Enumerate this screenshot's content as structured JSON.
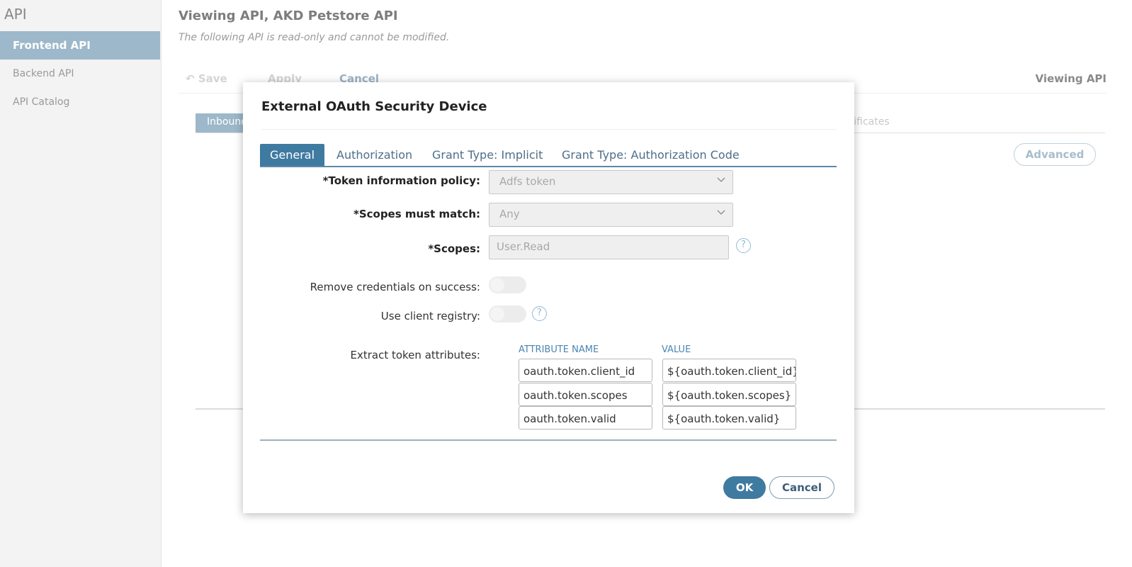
{
  "sidebar": {
    "title": "API",
    "items": [
      {
        "label": "Frontend API",
        "active": true
      },
      {
        "label": "Backend API",
        "active": false
      },
      {
        "label": "API Catalog",
        "active": false
      }
    ]
  },
  "header": {
    "title": "Viewing API, AKD Petstore API",
    "subtitle": "The following API is read-only and cannot be modified."
  },
  "toolbar": {
    "save_label": "Save",
    "apply_label": "Apply",
    "cancel_label": "Cancel",
    "right_label": "Viewing API"
  },
  "background": {
    "tab_inbound": "Inbound",
    "tab_certificates_partial": "rtificates",
    "advanced_label": "Advanced"
  },
  "modal": {
    "title": "External OAuth Security Device",
    "tabs": [
      {
        "label": "General",
        "active": true
      },
      {
        "label": "Authorization",
        "active": false
      },
      {
        "label": "Grant Type: Implicit",
        "active": false
      },
      {
        "label": "Grant Type: Authorization Code",
        "active": false
      }
    ],
    "fields": {
      "token_policy": {
        "label": "*Token information policy:",
        "value": "Adfs token"
      },
      "scopes_match": {
        "label": "*Scopes must match:",
        "value": "Any"
      },
      "scopes": {
        "label": "*Scopes:",
        "value": "User.Read"
      },
      "remove_credentials": {
        "label": "Remove credentials on success:",
        "enabled": false
      },
      "client_registry": {
        "label": "Use client registry:",
        "enabled": false
      },
      "extract_attrs": {
        "label": "Extract token attributes:"
      }
    },
    "help_glyph": "?",
    "attributes": {
      "col_name": "ATTRIBUTE NAME",
      "col_value": "VALUE",
      "rows": [
        {
          "name": "oauth.token.client_id",
          "value": "${oauth.token.client_id}"
        },
        {
          "name": "oauth.token.scopes",
          "value": "${oauth.token.scopes}"
        },
        {
          "name": "oauth.token.valid",
          "value": "${oauth.token.valid}"
        }
      ]
    },
    "ok_label": "OK",
    "cancel_label": "Cancel"
  },
  "icons": {
    "save": "undo-arrow-icon",
    "dropdown": "chevron-down-icon",
    "help": "help-circle-icon"
  }
}
